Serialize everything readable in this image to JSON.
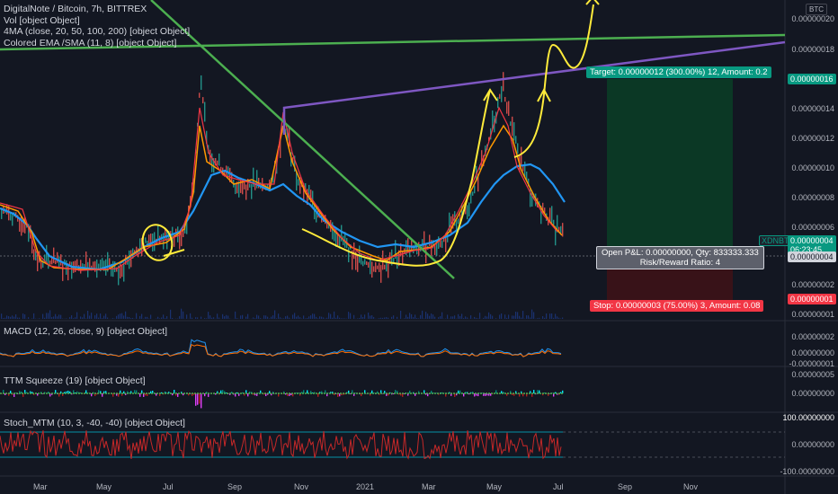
{
  "header": {
    "symbol_line": "DigitalNote / Bitcoin, 7h, BITTREX",
    "legend": [
      "Vol [object Object]",
      "4MA (close, 20, 50, 100, 200) [object Object]",
      "Colored EMA /SMA (11, 8) [object Object]"
    ]
  },
  "currency_badge": "BTC",
  "price_axis": [
    "0.00000020",
    "0.00000018",
    "0.00000014",
    "0.00000012",
    "0.00000010",
    "0.00000008",
    "0.00000006",
    "0.00000004",
    "0.00000002",
    "0.00000001"
  ],
  "price_tags": {
    "target_price": "0.00000016",
    "symbol": "XDNBTC",
    "last_price": "0.00000004",
    "countdown": "06:23:45",
    "current_price": "0.00000004",
    "stop_price": "0.00000001"
  },
  "position": {
    "target_label": "Target: 0.00000012 (300.00%) 12, Amount: 0.2",
    "open_pnl": "Open P&L: 0.00000000, Qty: 833333.333",
    "risk_reward": "Risk/Reward Ratio: 4",
    "stop_label": "Stop: 0.00000003 (75.00%) 3, Amount: 0.08"
  },
  "panes": {
    "macd": {
      "label": "MACD (12, 26, close, 9) [object Object]",
      "axis": [
        "0.00000002",
        "0.00000000",
        "-0.00000001"
      ]
    },
    "ttm": {
      "label": "TTM Squeeze (19) [object Object]",
      "axis": [
        "0.00000005",
        "0.00000000"
      ]
    },
    "stoch": {
      "label": "Stoch_MTM (10, 3, -40, -40) [object Object]",
      "axis": [
        "100.00000000",
        "0.00000000",
        "-100.00000000"
      ]
    }
  },
  "time_axis": [
    "Mar",
    "May",
    "Jul",
    "Sep",
    "Nov",
    "2021",
    "Mar",
    "May",
    "Jul",
    "Sep",
    "Nov"
  ],
  "colors": {
    "background": "#131722",
    "green_trendline": "#4caf50",
    "purple_trendline": "#7e57c2",
    "drawing_yellow": "#ffeb3b",
    "ma_blue": "#2196f3",
    "ma_orange": "#ff9800",
    "target_green": "#089981",
    "stop_red": "#f23645"
  }
}
